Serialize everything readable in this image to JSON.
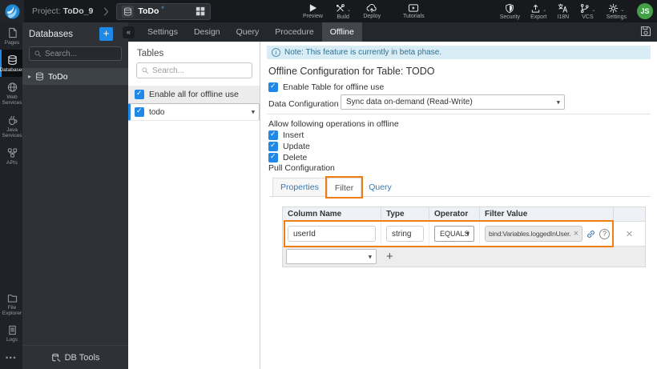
{
  "topbar": {
    "project_label": "Project:",
    "project_name": "ToDo_9",
    "workspace_tab": {
      "name": "ToDo",
      "dirty": "*"
    },
    "preview": "Preview",
    "build": "Build",
    "deploy": "Deploy",
    "tutorials": "Tutorials",
    "security": "Security",
    "export": "Export",
    "i18n": "I18N",
    "vcs": "VCS",
    "settings": "Settings",
    "avatar": "JS"
  },
  "rail": {
    "items": [
      {
        "label": "Pages",
        "icon": "page-icon",
        "active": false
      },
      {
        "label": "Databases",
        "icon": "database-icon",
        "active": true
      },
      {
        "label": "Web Services",
        "icon": "globe-icon",
        "active": false
      },
      {
        "label": "Java Services",
        "icon": "coffee-icon",
        "active": false
      },
      {
        "label": "APIs",
        "icon": "api-icon",
        "active": false
      }
    ],
    "bottom_items": [
      {
        "label": "File Explorer",
        "icon": "folder-icon"
      },
      {
        "label": "Logs",
        "icon": "document-icon"
      }
    ],
    "more": "•••"
  },
  "db_panel": {
    "title": "Databases",
    "add_button": "+",
    "collapse_glyph": "«",
    "search_placeholder": "Search...",
    "tree_item": "ToDo",
    "footer": "DB Tools"
  },
  "editor_tabs": {
    "items": [
      "Settings",
      "Design",
      "Query",
      "Procedure",
      "Offline"
    ],
    "active": "Offline"
  },
  "tables_panel": {
    "title": "Tables",
    "search_placeholder": "Search...",
    "rows": [
      {
        "label": "Enable all for offline use",
        "checked": true
      },
      {
        "label": "todo",
        "checked": true,
        "selected": true
      }
    ]
  },
  "main": {
    "note": "Note: This feature is currently in beta phase.",
    "heading": "Offline Configuration for Table: TODO",
    "enable_label": "Enable Table for offline use",
    "data_config_label": "Data Configuration",
    "data_config_value": "Sync data on-demand (Read-Write)",
    "operations_label": "Allow following operations in offline",
    "operations": [
      "Insert",
      "Update",
      "Delete"
    ],
    "pull_label": "Pull Configuration",
    "subtabs": [
      "Properties",
      "Filter",
      "Query"
    ],
    "active_subtab": "Filter",
    "filter_table": {
      "headers": [
        "Column Name",
        "Type",
        "Operator",
        "Filter Value"
      ],
      "row": {
        "column_name": "userId",
        "type": "string",
        "operator": "EQUALS",
        "filter_value": "bind:Variables.loggedInUser.data"
      },
      "add_label": "+"
    }
  },
  "colors": {
    "accent_blue": "#2089e8",
    "annotation_orange": "#ee7e12",
    "link_blue": "#337ab7",
    "avatar_green": "#43a047",
    "note_bg": "#d9edf7"
  }
}
